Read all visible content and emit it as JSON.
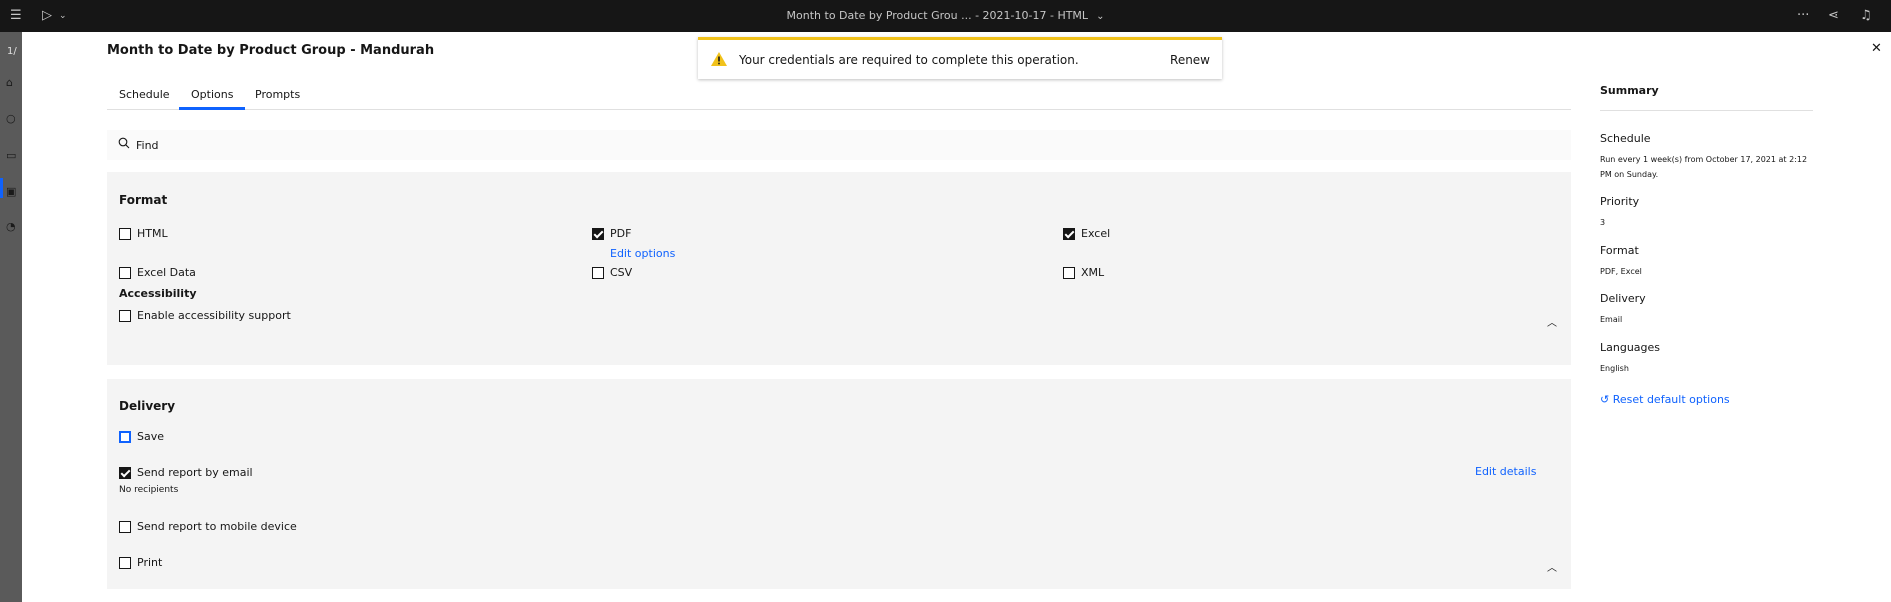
{
  "window": {
    "title": "Month to Date by Product Grou ... - 2021-10-17 - HTML"
  },
  "leftrail": {
    "page_indicator": "1/"
  },
  "panel": {
    "title": "Month to Date by Product Group - Mandurah",
    "tabs": [
      {
        "label": "Schedule",
        "active": false
      },
      {
        "label": "Options",
        "active": true
      },
      {
        "label": "Prompts",
        "active": false
      }
    ],
    "search": {
      "placeholder": "Find"
    }
  },
  "toast": {
    "message": "Your credentials are required to complete this operation.",
    "action": "Renew",
    "accent_color": "#f1c21b"
  },
  "format": {
    "title": "Format",
    "options": {
      "html": {
        "label": "HTML",
        "checked": false
      },
      "pdf": {
        "label": "PDF",
        "checked": true
      },
      "excel": {
        "label": "Excel",
        "checked": true
      },
      "excel_data": {
        "label": "Excel Data",
        "checked": false
      },
      "csv": {
        "label": "CSV",
        "checked": false
      },
      "xml": {
        "label": "XML",
        "checked": false
      }
    },
    "edit_options": "Edit options",
    "accessibility_title": "Accessibility",
    "accessibility_label": "Enable accessibility support"
  },
  "delivery": {
    "title": "Delivery",
    "save": "Save",
    "email": "Send report by email",
    "no_recipients": "No recipients",
    "edit_details": "Edit details",
    "mobile": "Send report to mobile device",
    "print": "Print"
  },
  "summary": {
    "title": "Summary",
    "schedule_label": "Schedule",
    "schedule_value": "Run every 1 week(s) from October 17, 2021 at 2:12 PM on Sunday.",
    "priority_label": "Priority",
    "priority_value": "3",
    "format_label": "Format",
    "format_value": "PDF, Excel",
    "delivery_label": "Delivery",
    "delivery_value": "Email",
    "languages_label": "Languages",
    "languages_value": "English",
    "reset": "Reset default options"
  },
  "colors": {
    "accent": "#0f62fe",
    "topbar": "#161616",
    "section_bg": "#f4f4f4"
  }
}
